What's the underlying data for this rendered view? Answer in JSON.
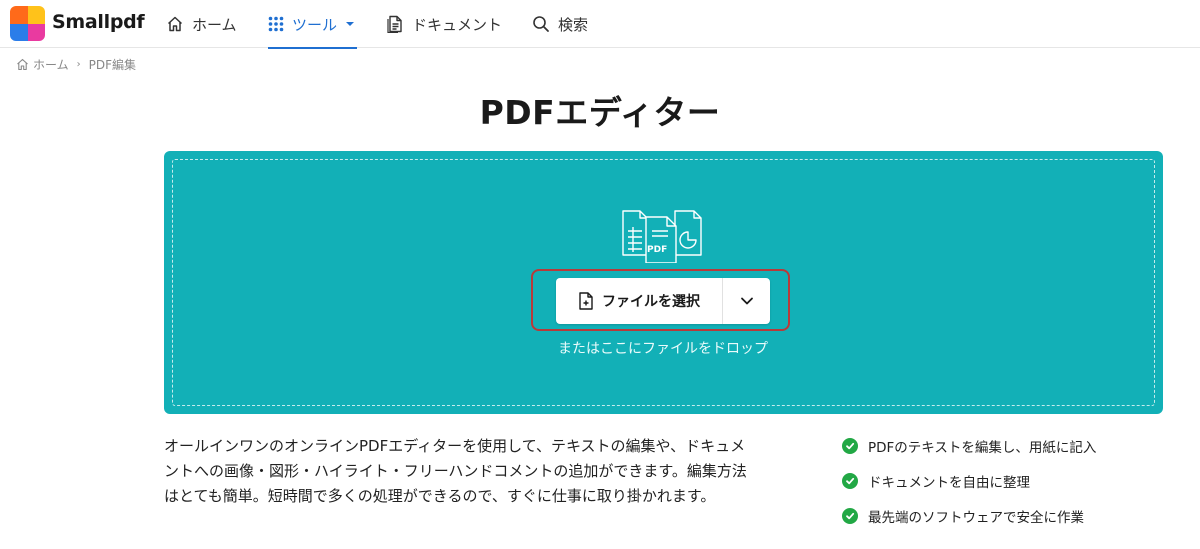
{
  "brand": {
    "name": "Smallpdf",
    "logo_colors": [
      "#ff6a1a",
      "#ffc21a",
      "#2b7de9",
      "#e93aa0"
    ]
  },
  "nav": {
    "home_label": "ホーム",
    "tools_label": "ツール",
    "documents_label": "ドキュメント",
    "search_label": "検索",
    "active_color": "#1f6fd1"
  },
  "breadcrumb": {
    "home": "ホーム",
    "current": "PDF編集"
  },
  "page": {
    "title": "PDFエディター"
  },
  "dropzone": {
    "background_color": "#12b0b7",
    "choose_file_label": "ファイルを選択",
    "drop_hint": "またはここにファイルをドロップ",
    "badge": "PDF",
    "highlight_color": "#b83a3a"
  },
  "description": "オールインワンのオンラインPDFエディターを使用して、テキストの編集や、ドキュメントへの画像・図形・ハイライト・フリーハンドコメントの追加ができます。編集方法はとても簡単。短時間で多くの処理ができるので、すぐに仕事に取り掛かれます。",
  "features": [
    "PDFのテキストを編集し、用紙に記入",
    "ドキュメントを自由に整理",
    "最先端のソフトウェアで安全に作業"
  ],
  "check_color": "#22a845"
}
